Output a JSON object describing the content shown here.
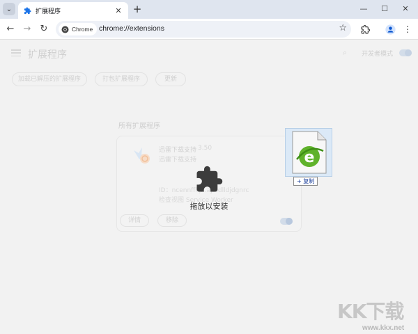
{
  "browser": {
    "tab": {
      "title": "扩展程序",
      "close_glyph": "✕"
    },
    "new_tab_glyph": "+",
    "window_controls": {
      "minimize": "—",
      "maximize": "☐",
      "close": "✕"
    },
    "nav": {
      "back": "←",
      "forward": "→",
      "reload": "↻"
    },
    "omnibox": {
      "chip_label": "Chrome",
      "url": "chrome://extensions"
    },
    "icons": [
      "tab-search-icon",
      "puzzle-icon",
      "chrome-logo-icon",
      "star-icon",
      "profile-icon",
      "kebab-menu-icon"
    ]
  },
  "extensions_page": {
    "title": "扩展程序",
    "developer_mode_label": "开发者模式",
    "developer_mode": true,
    "buttons": {
      "load_unpacked": "加载已解压的扩展程序",
      "pack": "打包扩展程序",
      "update": "更新"
    },
    "section_title": "所有扩展程序",
    "extension": {
      "name": "迅雷下载支持",
      "version": "3.50",
      "description": "迅雷下载支持",
      "id": "ID：ncennffkj...ajlbdlldjdgnrc",
      "inspect": "检查视图 Service Worker",
      "details_label": "详情",
      "remove_label": "移除",
      "enabled": true
    }
  },
  "drop_overlay": {
    "label": "拖放以安装"
  },
  "drag": {
    "badge_plus": "+",
    "badge_label": "复制"
  },
  "watermark": {
    "logo": "KK下载",
    "url": "www.kkx.net"
  },
  "colors": {
    "accent": "#0b57d0",
    "toolbar": "#ffffff",
    "tabstrip": "#dfe5ef",
    "dim_page": "#f2f2f2"
  }
}
